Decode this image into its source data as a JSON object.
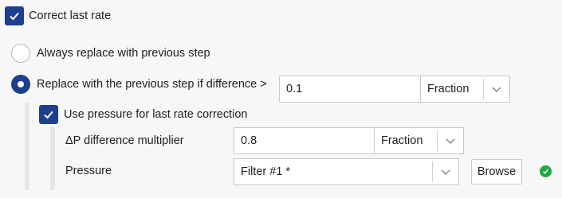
{
  "correct_last_rate": {
    "label": "Correct last rate",
    "checked": true
  },
  "radio_options": [
    {
      "label": "Always replace with previous step",
      "selected": false
    },
    {
      "label": "Replace with the previous step if difference >",
      "selected": true
    }
  ],
  "difference": {
    "value": "0.1",
    "unit": "Fraction"
  },
  "use_pressure": {
    "label": "Use pressure for last rate correction",
    "checked": true
  },
  "dp_multiplier": {
    "label": "ΔP difference multiplier",
    "value": "0.8",
    "unit": "Fraction"
  },
  "pressure": {
    "label": "Pressure",
    "value": "Filter #1 *",
    "browse_label": "Browse",
    "status": "valid"
  },
  "colors": {
    "accent": "#1e3f8f",
    "status_ok": "#20a83e"
  },
  "icons": {
    "check": "check-icon",
    "dropdown": "chevron-down-icon",
    "status": "status-ok-icon"
  }
}
